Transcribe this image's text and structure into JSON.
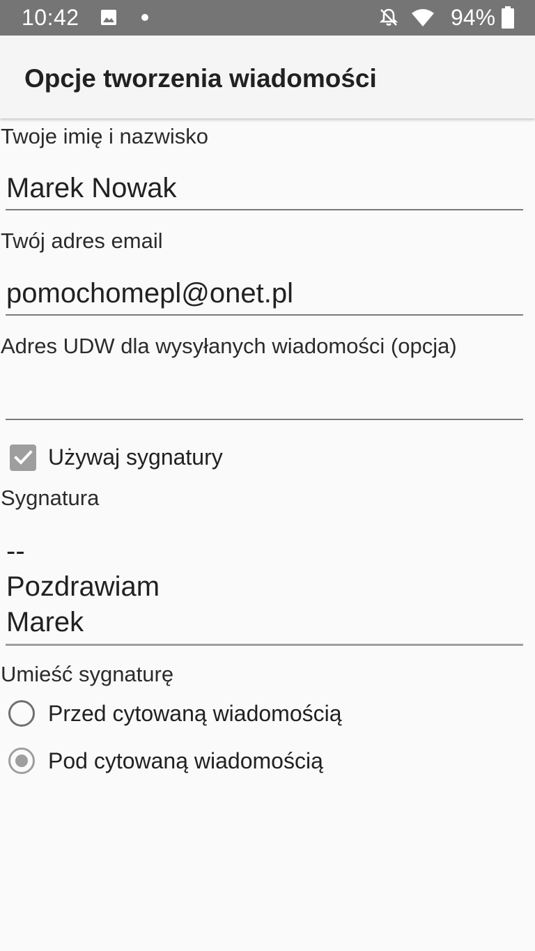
{
  "status_bar": {
    "time": "10:42",
    "battery": "94%",
    "icons": [
      "gallery-icon",
      "notification-dot",
      "bell-off-icon",
      "wifi-icon",
      "battery-icon"
    ]
  },
  "app_bar": {
    "title": "Opcje tworzenia wiadomości"
  },
  "form": {
    "name": {
      "label": "Twoje imię i nazwisko",
      "value": "Marek Nowak"
    },
    "email": {
      "label": "Twój adres email",
      "value": "pomochomepl@onet.pl"
    },
    "bcc": {
      "label": "Adres UDW dla wysyłanych wiadomości (opcja)",
      "value": ""
    },
    "use_signature": {
      "label": "Używaj sygnatury",
      "checked": true
    },
    "signature": {
      "label": "Sygnatura",
      "value": "--\nPozdrawiam\nMarek"
    },
    "signature_position": {
      "label": "Umieść sygnaturę",
      "options": [
        {
          "label": "Przed cytowaną wiadomością",
          "selected": false
        },
        {
          "label": "Pod cytowaną wiadomością",
          "selected": true
        }
      ]
    }
  },
  "colors": {
    "status_bar_bg": "#757575",
    "app_bar_bg": "#f5f5f5",
    "page_bg": "#fafafa",
    "control_gray": "#9e9e9e"
  }
}
